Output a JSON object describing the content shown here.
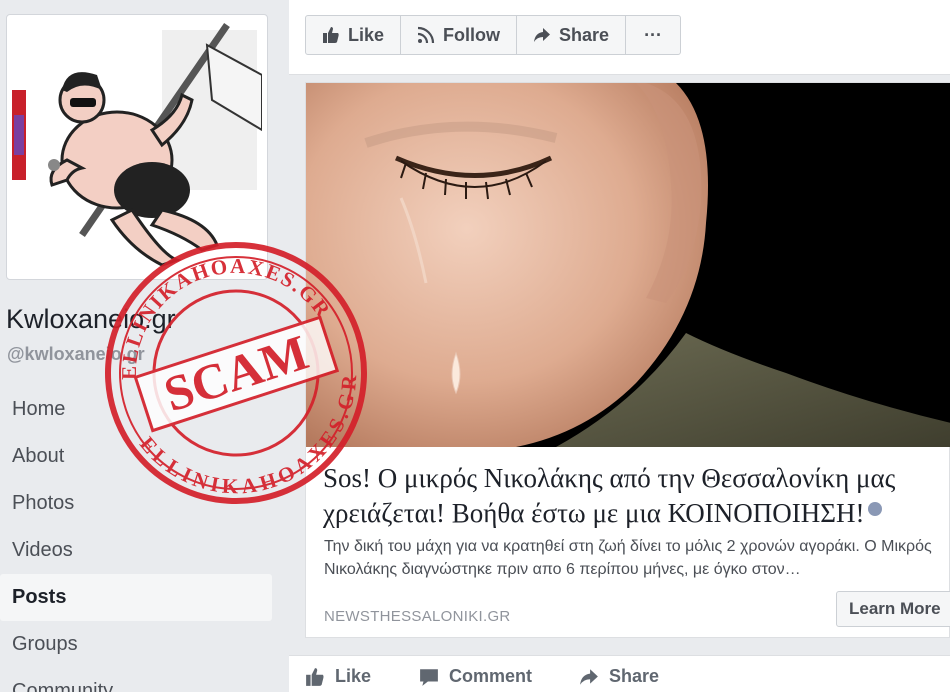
{
  "page": {
    "name": "Kwloxaneio.gr",
    "handle": "@kwloxaneio.gr"
  },
  "nav": [
    {
      "label": "Home"
    },
    {
      "label": "About"
    },
    {
      "label": "Photos"
    },
    {
      "label": "Videos"
    },
    {
      "label": "Posts",
      "active": true
    },
    {
      "label": "Groups"
    },
    {
      "label": "Community"
    }
  ],
  "toolbar": {
    "like": "Like",
    "follow": "Follow",
    "share": "Share",
    "more": "···"
  },
  "post": {
    "headline": "Sos! Ο μικρός Νικολάκης από την Θεσσαλονίκη μας χρειάζεται! Βοήθα έστω με μια ΚΟΙΝΟΠΟΙΗΣΗ!",
    "description": "Την δική του μάχη για να κρατηθεί στη ζωή δίνει το μόλις 2 χρονών αγοράκι. Ο Μικρός Νικολάκης διαγνώστηκε πριν απο 6 περίπου μήνες, με όγκο στον…",
    "domain": "NEWSTHESSALONIKI.GR",
    "cta": "Learn More"
  },
  "actions": {
    "like": "Like",
    "comment": "Comment",
    "share": "Share"
  },
  "stamp": {
    "label": "SCAM",
    "ring_text": "ELLINIKAHOAXES.GR",
    "color": "#d4202a"
  },
  "colors": {
    "background": "#e9ebee",
    "card": "#ffffff",
    "muted_text": "#90949c"
  }
}
